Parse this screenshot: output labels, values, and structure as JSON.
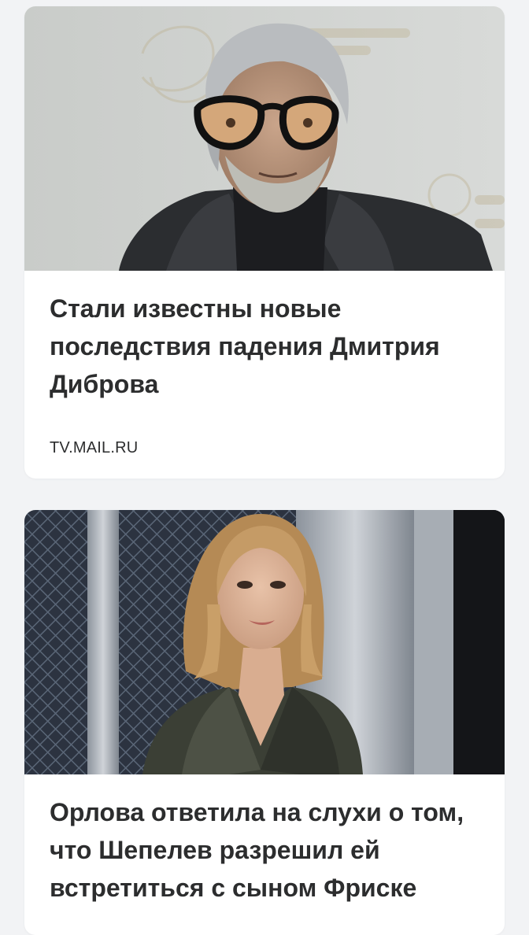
{
  "feed": {
    "cards": [
      {
        "title": "Стали известны новые последствия падения Дмитрия Диброва",
        "source": "TV.MAIL.RU",
        "image": "photo-man-glasses"
      },
      {
        "title": "Орлова ответила на слухи о том, что Шепелев разрешил ей встретиться с сыном Фриске",
        "image": "photo-woman-blonde"
      }
    ]
  },
  "colors": {
    "page_background": "#f2f3f5",
    "card_background": "#ffffff",
    "text": "#2c2d2e"
  }
}
